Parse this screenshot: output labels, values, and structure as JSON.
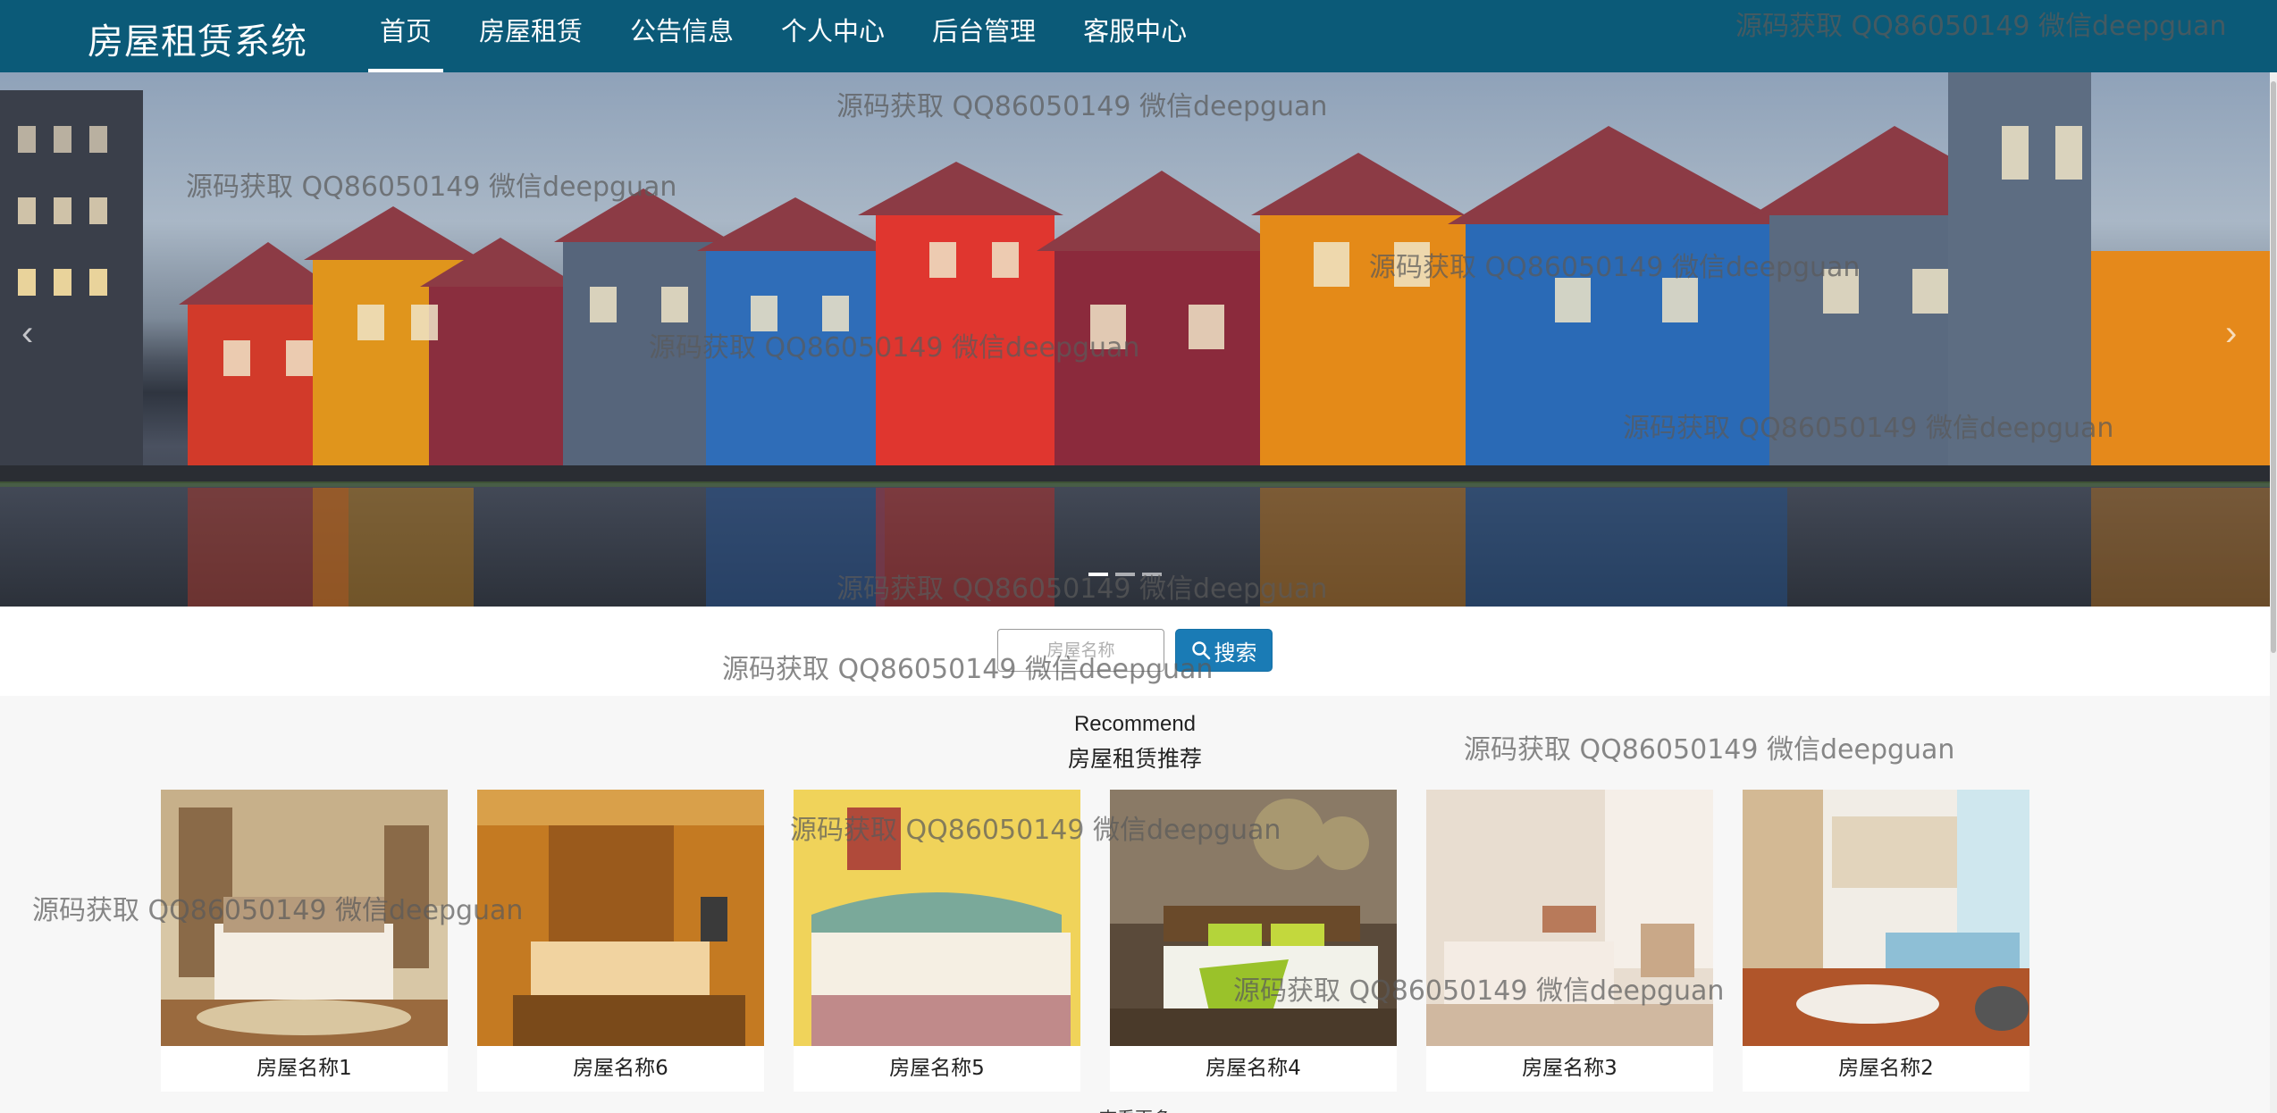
{
  "app": {
    "brand": "房屋租赁系统"
  },
  "nav": {
    "items": [
      {
        "label": "首页",
        "active": true
      },
      {
        "label": "房屋租赁"
      },
      {
        "label": "公告信息"
      },
      {
        "label": "个人中心"
      },
      {
        "label": "后台管理"
      },
      {
        "label": "客服中心"
      }
    ]
  },
  "banner": {
    "slide_count": 3,
    "active_slide": 1,
    "prev_icon": "chevron-left",
    "next_icon": "chevron-right"
  },
  "search": {
    "placeholder": "房屋名称",
    "button_label": "搜索",
    "button_icon": "search-icon"
  },
  "section": {
    "title_en": "Recommend",
    "title_zh": "房屋租赁推荐",
    "more_label": "查看更多",
    "items": [
      {
        "name": "房屋名称1"
      },
      {
        "name": "房屋名称6"
      },
      {
        "name": "房屋名称5"
      },
      {
        "name": "房屋名称4"
      },
      {
        "name": "房屋名称3"
      },
      {
        "name": "房屋名称2"
      }
    ]
  },
  "watermark": {
    "text": "源码获取 QQ86050149 微信deepguan"
  },
  "colors": {
    "navbar": "#0b5a78",
    "search_button": "#1a7bb5",
    "section_bg": "#f7f7f7"
  }
}
